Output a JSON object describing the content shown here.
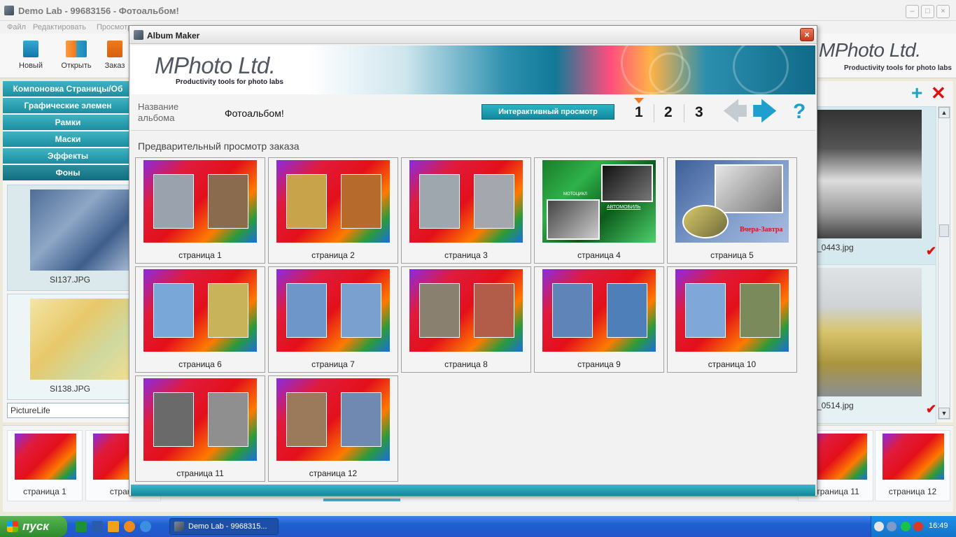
{
  "main_window": {
    "title": "Demo Lab - 99683156 - Фотоальбом!",
    "menu": [
      "Файл",
      "Редактировать",
      "Просмотр"
    ],
    "toolbar": [
      {
        "label": "Новый",
        "icon": "new-document-icon"
      },
      {
        "label": "Открыть",
        "icon": "open-book-icon"
      },
      {
        "label": "Заказ",
        "icon": "cart-icon"
      }
    ],
    "brand": {
      "logo": "MPhoto Ltd.",
      "tagline": "Productivity tools for photo labs"
    },
    "left_panel": {
      "categories": [
        "Компоновка Страницы/Об",
        "Графические элемен",
        "Рамки",
        "Маски",
        "Эффекты",
        "Фоны"
      ],
      "active_category": "Фоны",
      "backgrounds": [
        {
          "name": "SI137.JPG"
        },
        {
          "name": "SI138.JPG"
        }
      ],
      "source_input": "PictureLife"
    },
    "right_panel": {
      "add_icon": "plus-icon",
      "remove_icon": "x-icon",
      "photos": [
        {
          "name": "_0443.jpg",
          "checked_icon": "✔"
        },
        {
          "name": "_0514.jpg",
          "checked_icon": "✔"
        }
      ]
    },
    "filmstrip": [
      {
        "label": "страница 1"
      },
      {
        "label": "страни"
      },
      {
        "label": "страница 11"
      },
      {
        "label": "страница 12"
      }
    ]
  },
  "dialog": {
    "title": "Album Maker",
    "close_icon": "×",
    "banner": {
      "logo": "MPhoto Ltd.",
      "tagline": "Productivity tools for photo labs"
    },
    "album_name_label": "Название альбома",
    "album_name_value": "Фотоальбом!",
    "interactive_preview_label": "Интерактивный просмотр",
    "steps": [
      "1",
      "2",
      "3"
    ],
    "active_step": "1",
    "back_arrow": "🡄",
    "forward_arrow": "🡆",
    "help_icon": "?",
    "preview_title": "Предварительный просмотр заказа",
    "pages": [
      {
        "label": "страница 1",
        "style": "spread",
        "left": "#9aa3ad",
        "right": "#8b6b4e"
      },
      {
        "label": "страница 2",
        "style": "spread",
        "left": "#c9a34a",
        "right": "#b66a2c"
      },
      {
        "label": "страница 3",
        "style": "spread",
        "left": "#9ea6ae",
        "right": "#a4a8ae"
      },
      {
        "label": "страница 4",
        "style": "dark",
        "overlay_text_1": "МОТОЦИКЛ",
        "overlay_text_2": "АВТОМОБИЛЬ"
      },
      {
        "label": "страница 5",
        "style": "blu",
        "overlay_text": "Вчера-Завтра"
      },
      {
        "label": "страница 6",
        "style": "spread",
        "left": "#79a8d8",
        "right": "#c8b35a"
      },
      {
        "label": "страница 7",
        "style": "spread",
        "left": "#6f96c8",
        "right": "#7aa0cf"
      },
      {
        "label": "страница 8",
        "style": "spread",
        "left": "#8a8070",
        "right": "#b25d4a"
      },
      {
        "label": "страница 9",
        "style": "spread",
        "left": "#5f84b8",
        "right": "#4f7fb8"
      },
      {
        "label": "страница 10",
        "style": "spread",
        "left": "#7fa7d8",
        "right": "#7a8a5a"
      },
      {
        "label": "страница 11",
        "style": "spread",
        "left": "#6a6a6a",
        "right": "#8f8f8f"
      },
      {
        "label": "страница 12",
        "style": "spread",
        "left": "#9a7a5a",
        "right": "#6f89b0"
      }
    ]
  },
  "taskbar": {
    "start_label": "пуск",
    "task_title": "Demo Lab - 9968315...",
    "clock": "16:49"
  }
}
